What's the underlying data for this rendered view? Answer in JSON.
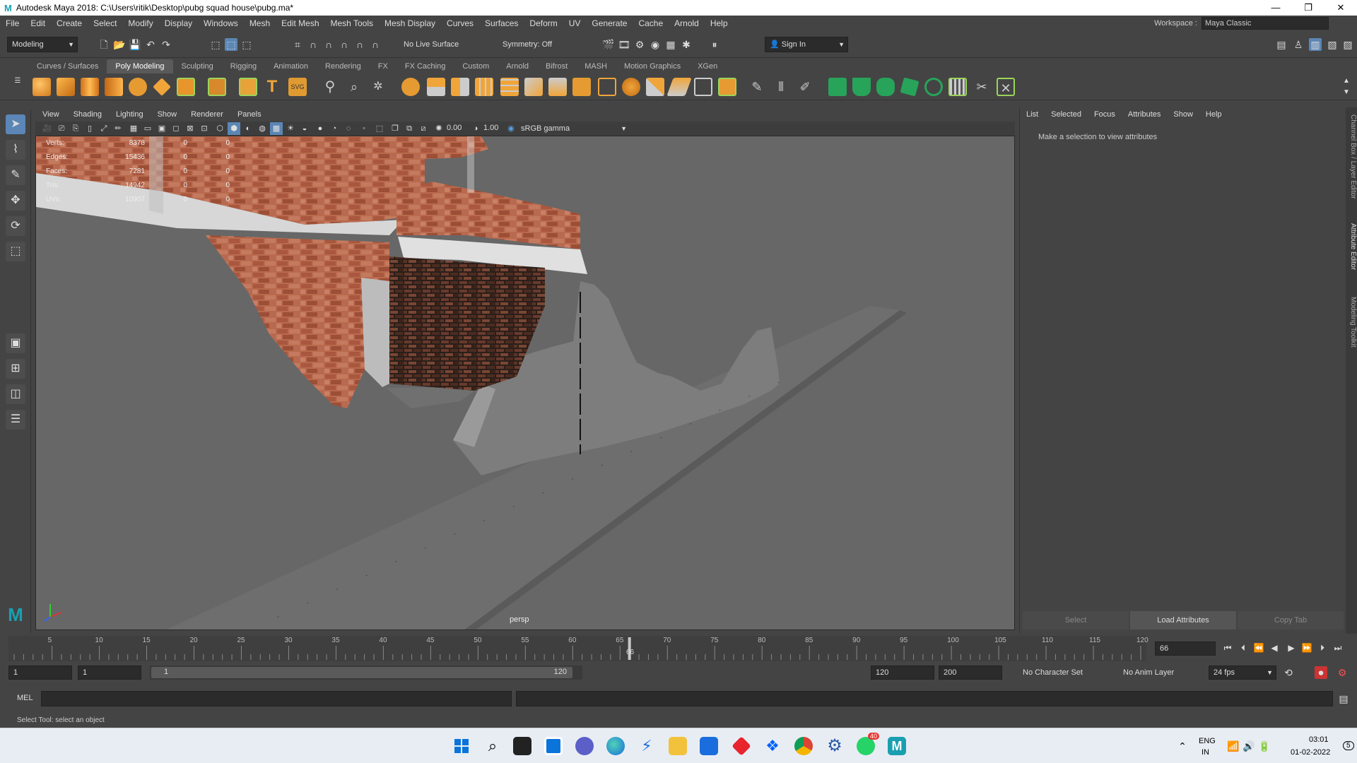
{
  "window": {
    "title": "Autodesk Maya 2018: C:\\Users\\ritik\\Desktop\\pubg squad house\\pubg.ma*",
    "min": "—",
    "max": "❐",
    "close": "✕"
  },
  "menus": [
    "File",
    "Edit",
    "Create",
    "Select",
    "Modify",
    "Display",
    "Windows",
    "Mesh",
    "Edit Mesh",
    "Mesh Tools",
    "Mesh Display",
    "Curves",
    "Surfaces",
    "Deform",
    "UV",
    "Generate",
    "Cache",
    "Arnold",
    "Help"
  ],
  "workspace": {
    "label": "Workspace :",
    "value": "Maya Classic"
  },
  "status": {
    "mode": "Modeling",
    "live_surface": "No Live Surface",
    "symmetry": "Symmetry: Off",
    "sign_in": "Sign In"
  },
  "shelf_tabs": [
    "Curves / Surfaces",
    "Poly Modeling",
    "Sculpting",
    "Rigging",
    "Animation",
    "Rendering",
    "FX",
    "FX Caching",
    "Custom",
    "Arnold",
    "Bifrost",
    "MASH",
    "Motion Graphics",
    "XGen"
  ],
  "shelf_active": "Poly Modeling",
  "viewport_menu": [
    "View",
    "Shading",
    "Lighting",
    "Show",
    "Renderer",
    "Panels"
  ],
  "viewport_toolbar": {
    "exposure": "0.00",
    "gamma": "1.00",
    "color_space": "sRGB gamma"
  },
  "hud": [
    {
      "label": "Verts:",
      "value": "8378",
      "c1": "0",
      "c2": "0"
    },
    {
      "label": "Edges:",
      "value": "15436",
      "c1": "0",
      "c2": "0"
    },
    {
      "label": "Faces:",
      "value": "7281",
      "c1": "0",
      "c2": "0"
    },
    {
      "label": "Tris:",
      "value": "14942",
      "c1": "0",
      "c2": "0"
    },
    {
      "label": "UVs:",
      "value": "10907",
      "c1": "0",
      "c2": "0"
    }
  ],
  "camera_label": "persp",
  "attr_menu": [
    "List",
    "Selected",
    "Focus",
    "Attributes",
    "Show",
    "Help"
  ],
  "attr_message": "Make a selection to view attributes",
  "attr_buttons": {
    "select": "Select",
    "load": "Load Attributes",
    "copy": "Copy Tab"
  },
  "side_tabs": [
    "Channel Box / Layer Editor",
    "Attribute Editor",
    "Modeling Toolkit"
  ],
  "timeline": {
    "ticks": [
      "5",
      "10",
      "15",
      "20",
      "25",
      "30",
      "35",
      "40",
      "45",
      "50",
      "55",
      "60",
      "65",
      "70",
      "75",
      "80",
      "85",
      "90",
      "95",
      "100",
      "105",
      "110",
      "115",
      "120"
    ],
    "current": "66",
    "current_field": "66"
  },
  "range": {
    "start": "1",
    "start2": "1",
    "slider_start": "1",
    "slider_end": "120",
    "end": "120",
    "end2": "200",
    "char_set": "No Character Set",
    "anim_layer": "No Anim Layer",
    "fps": "24 fps"
  },
  "cmd": {
    "label": "MEL"
  },
  "help_line": "Select Tool: select an object",
  "taskbar": {
    "lang": "ENG",
    "region": "IN",
    "time": "03:01",
    "date": "01-02-2022",
    "notif_count": "5",
    "whatsapp_badge": "40"
  }
}
